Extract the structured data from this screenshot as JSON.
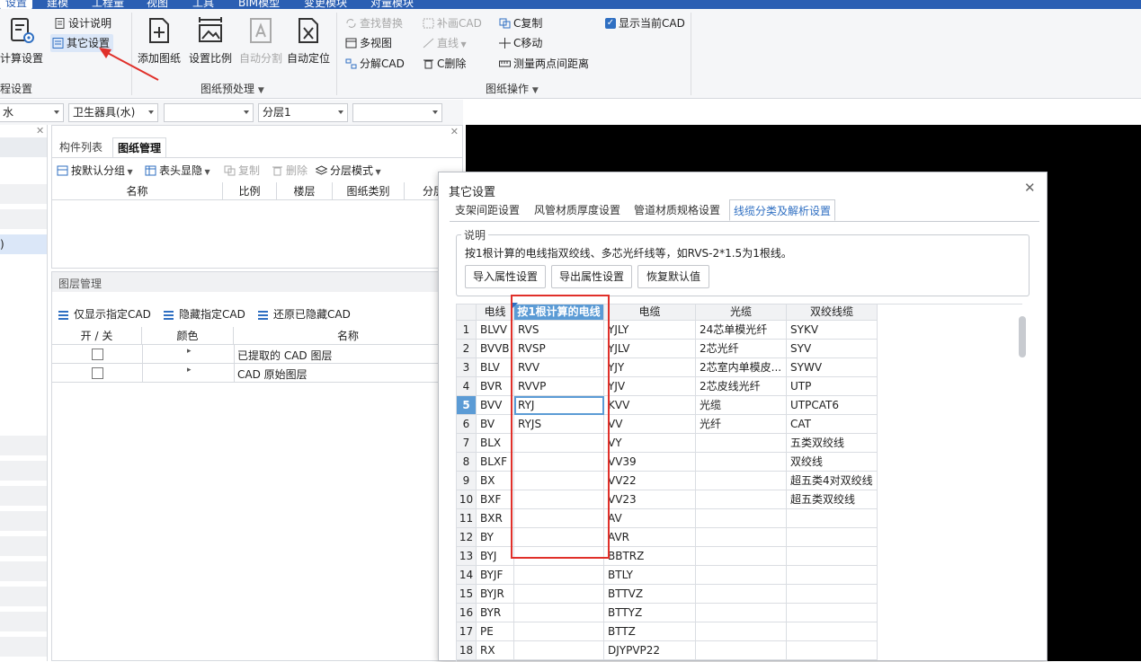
{
  "menubar": {
    "items": [
      "设置",
      "建模",
      "工程量",
      "视图",
      "工具",
      "BIM模型",
      "变更模块",
      "对量模块"
    ]
  },
  "ribbon": {
    "project_group": {
      "calc_settings": "计算设置",
      "design_notes": "设计说明",
      "other_settings": "其它设置",
      "label": "程设置"
    },
    "drawing_preprocess": {
      "add_drawing": "添加图纸",
      "set_scale": "设置比例",
      "auto_split": "自动分割",
      "auto_locate": "自动定位",
      "label": "图纸预处理"
    },
    "drawing_ops": {
      "find_replace": "查找替换",
      "multi_view": "多视图",
      "split_cad": "分解CAD",
      "complete_cad": "补画CAD",
      "line": "直线",
      "c_delete": "C删除",
      "c_copy": "C复制",
      "c_move": "C移动",
      "measure": "测量两点间距离",
      "show_cad": "显示当前CAD",
      "label": "图纸操作"
    }
  },
  "filters": {
    "f1": "水",
    "f2": "卫生器具(水)",
    "f3": "",
    "f4": "分层1",
    "f5": ""
  },
  "left_stub": {
    "paren": ")"
  },
  "component_panel": {
    "tabs": [
      "构件列表",
      "图纸管理"
    ],
    "toolbar": {
      "group_default": "按默认分组",
      "header_toggle": "表头显隐",
      "copy": "复制",
      "delete": "删除",
      "layer_mode": "分层模式"
    },
    "columns": [
      "名称",
      "比例",
      "楼层",
      "图纸类别",
      "分层"
    ]
  },
  "layer_panel": {
    "title": "图层管理",
    "toolbar": {
      "show_only": "仅显示指定CAD",
      "hide": "隐藏指定CAD",
      "restore": "还原已隐藏CAD"
    },
    "columns": [
      "开 / 关",
      "颜色",
      "名称"
    ],
    "rows": [
      {
        "name": "已提取的 CAD 图层"
      },
      {
        "name": "CAD 原始图层"
      }
    ]
  },
  "dialog": {
    "title": "其它设置",
    "tabs": [
      "支架间距设置",
      "风管材质厚度设置",
      "管道材质规格设置",
      "线缆分类及解析设置"
    ],
    "active_tab": 3,
    "note_legend": "说明",
    "note_text": "按1根计算的电线指双绞线、多芯光纤线等，如RVS-2*1.5为1根线。",
    "buttons": {
      "import": "导入属性设置",
      "export": "导出属性设置",
      "restore": "恢复默认值"
    },
    "grid": {
      "headers": [
        "电线",
        "按1根计算的电线",
        "电缆",
        "光缆",
        "双绞线缆"
      ],
      "rows": [
        [
          "1",
          "BLVV",
          "RVS",
          "YJLY",
          "24芯单模光纤",
          "SYKV"
        ],
        [
          "2",
          "BVVB",
          "RVSP",
          "YJLV",
          "2芯光纤",
          "SYV"
        ],
        [
          "3",
          "BLV",
          "RVV",
          "YJY",
          "2芯室内单模皮...",
          "SYWV"
        ],
        [
          "4",
          "BVR",
          "RVVP",
          "YJV",
          "2芯皮线光纤",
          "UTP"
        ],
        [
          "5",
          "BVV",
          "RYJ",
          "KVV",
          "光缆",
          "UTPCAT6"
        ],
        [
          "6",
          "BV",
          "RYJS",
          "VV",
          "光纤",
          "CAT"
        ],
        [
          "7",
          "BLX",
          "",
          "VY",
          "",
          "五类双绞线"
        ],
        [
          "8",
          "BLXF",
          "",
          "VV39",
          "",
          "双绞线"
        ],
        [
          "9",
          "BX",
          "",
          "VV22",
          "",
          "超五类4对双绞线"
        ],
        [
          "10",
          "BXF",
          "",
          "VV23",
          "",
          "超五类双绞线"
        ],
        [
          "11",
          "BXR",
          "",
          "AV",
          "",
          ""
        ],
        [
          "12",
          "BY",
          "",
          "AVR",
          "",
          ""
        ],
        [
          "13",
          "BYJ",
          "",
          "BBTRZ",
          "",
          ""
        ],
        [
          "14",
          "BYJF",
          "",
          "BTLY",
          "",
          ""
        ],
        [
          "15",
          "BYJR",
          "",
          "BTTVZ",
          "",
          ""
        ],
        [
          "16",
          "BYR",
          "",
          "BTTYZ",
          "",
          ""
        ],
        [
          "17",
          "PE",
          "",
          "BTTZ",
          "",
          ""
        ],
        [
          "18",
          "RX",
          "",
          "DJYPVP22",
          "",
          ""
        ]
      ],
      "selected_row": 5
    }
  },
  "colors": {
    "accent": "#2f6fc2",
    "highlight_border": "#e0302a",
    "header_selected": "#5b9bd5",
    "annotation_arrow": "#e0302a"
  }
}
